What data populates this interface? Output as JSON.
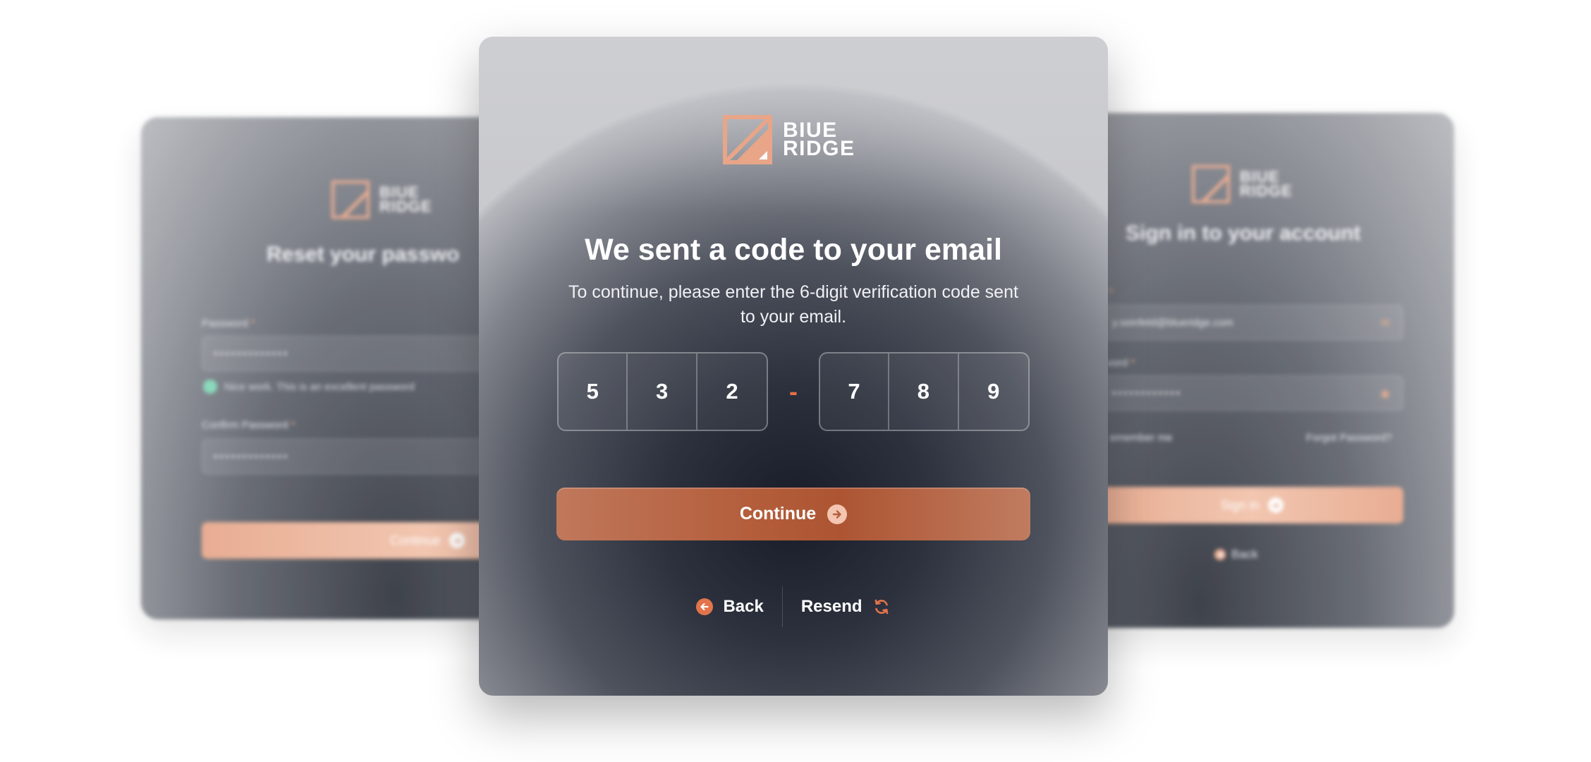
{
  "brand": {
    "line1": "BIUE",
    "line2": "RIDGE",
    "accent_color": "#e8a588"
  },
  "left_card": {
    "title": "Reset your passwo",
    "password_label": "Password",
    "password_value": "•••••••••••••",
    "strength_hint": "Nice work. This is an excellent password",
    "confirm_label": "Confirm Password",
    "confirm_value": "•••••••••••••",
    "continue_label": "Continue"
  },
  "right_card": {
    "title": "Sign in to your account",
    "email_label": "",
    "email_value": "y.seinfeld@blueridge.com",
    "password_label": "vord",
    "password_value": "••••••••••••",
    "remember_label": "emember me",
    "forgot_label": "Forgot Password?",
    "signin_label": "Sign in",
    "back_label": "Back"
  },
  "main": {
    "headline": "We sent a code to your email",
    "subtext": "To continue, please enter the 6-digit verification code sent to your email.",
    "code": {
      "first": [
        "5",
        "3",
        "2"
      ],
      "separator": "-",
      "second": [
        "7",
        "8",
        "9"
      ]
    },
    "continue_label": "Continue",
    "back_label": "Back",
    "resend_label": "Resend",
    "button_color": "#b45e3c",
    "icon_color": "#e3744a"
  }
}
